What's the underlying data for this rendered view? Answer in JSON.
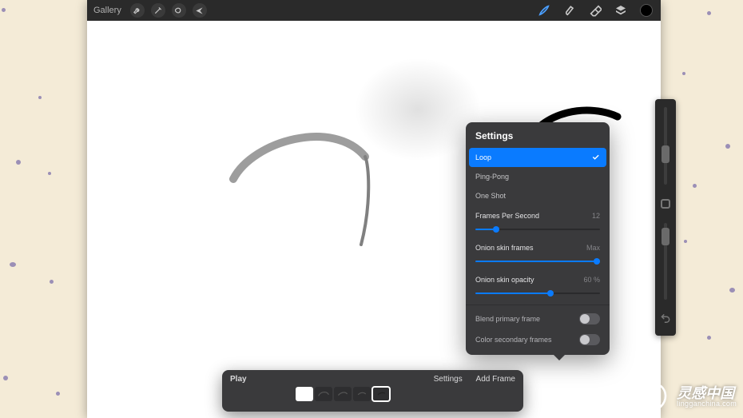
{
  "topbar": {
    "gallery": "Gallery",
    "accent": "#0a7bff"
  },
  "settings": {
    "title": "Settings",
    "options": [
      "Loop",
      "Ping-Pong",
      "One Shot"
    ],
    "selected": 0,
    "fps": {
      "label": "Frames Per Second",
      "value": "12",
      "pct": 16
    },
    "frames": {
      "label": "Onion skin frames",
      "value": "Max",
      "pct": 100
    },
    "opacity": {
      "label": "Onion skin opacity",
      "value": "60 %",
      "pct": 60
    },
    "toggles": [
      {
        "label": "Blend primary frame",
        "on": false
      },
      {
        "label": "Color secondary frames",
        "on": false
      }
    ]
  },
  "timeline": {
    "play": "Play",
    "settings": "Settings",
    "add": "Add Frame",
    "frame_count": 5
  },
  "watermark": {
    "zh": "灵感中国",
    "domain": "lingganchina.com"
  }
}
